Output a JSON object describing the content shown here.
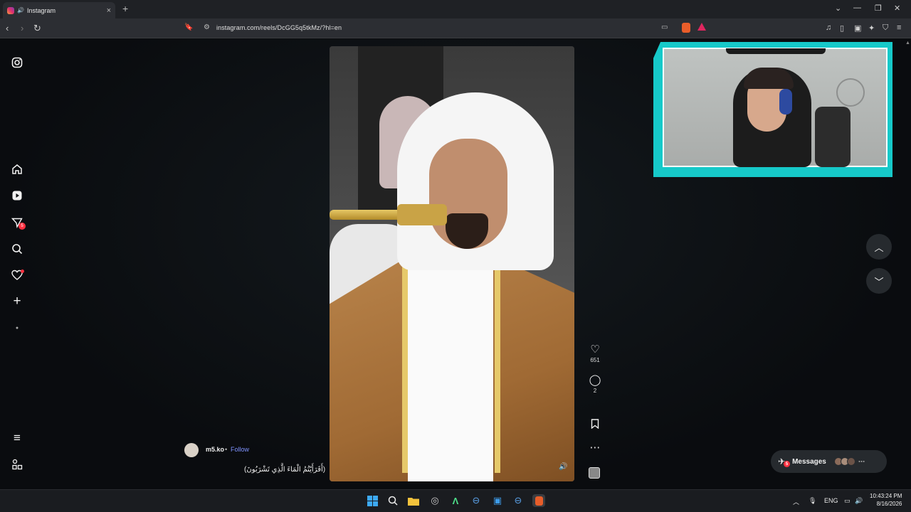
{
  "browser": {
    "tab_title": "Instagram",
    "new_tab": "+",
    "url": "instagram.com/reels/DcGG5q5tkMz/?hl=en"
  },
  "sidebar": {
    "notification_count": "5"
  },
  "reel": {
    "likes": "651",
    "comments": "2",
    "author": "m5.ko",
    "separator": "•",
    "follow_label": "Follow",
    "caption": "(أَفَرَأَيْتُمُ الْمَاءَ الَّذِي تَشْرَبُونَ)"
  },
  "messages": {
    "label": "Messages",
    "badge": "5"
  },
  "taskbar": {
    "language": "ENG",
    "time": "10:43:24 PM",
    "date": "8/16/2026"
  },
  "colors": {
    "accent_follow": "#7f93ff",
    "badge_red": "#ff3040",
    "webcam_frame": "#16c9c9"
  }
}
